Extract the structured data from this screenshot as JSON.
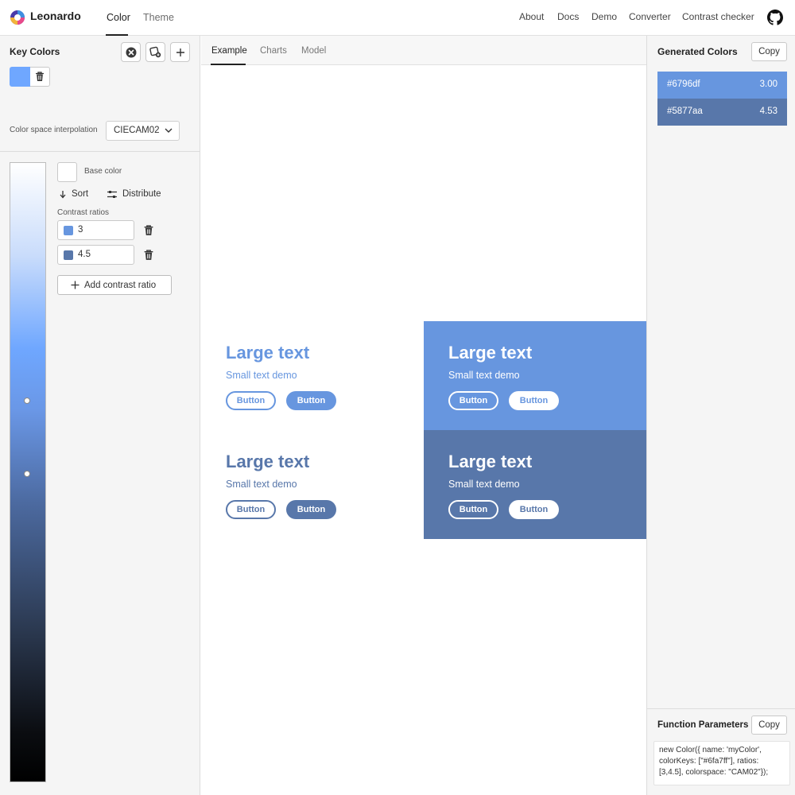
{
  "header": {
    "app_title": "Leonardo",
    "tabs": [
      {
        "label": "Color",
        "active": true
      },
      {
        "label": "Theme",
        "active": false
      }
    ],
    "nav": [
      "About",
      "Docs",
      "Demo",
      "Converter",
      "Contrast checker"
    ],
    "icons": {
      "logo": "leonardo-logo-icon",
      "github": "github-icon"
    }
  },
  "left_panel": {
    "key_colors_title": "Key Colors",
    "key_colors": [
      "#6fa7ff"
    ],
    "interpolation_label": "Color space interpolation",
    "interpolation_value": "CIECAM02",
    "base_color_label": "Base color",
    "sort_label": "Sort",
    "distribute_label": "Distribute",
    "contrast_ratios_label": "Contrast ratios",
    "ratios": [
      {
        "value": "3",
        "color": "#6796df"
      },
      {
        "value": "4.5",
        "color": "#5877aa"
      }
    ],
    "add_ratio_label": "Add contrast ratio"
  },
  "main": {
    "tabs": [
      {
        "label": "Example",
        "active": true
      },
      {
        "label": "Charts",
        "active": false
      },
      {
        "label": "Model",
        "active": false
      }
    ],
    "demo": {
      "large_text": "Large text",
      "small_text": "Small text demo",
      "button_label": "Button"
    }
  },
  "right_panel": {
    "generated_title": "Generated Colors",
    "copy_label": "Copy",
    "generated": [
      {
        "hex": "#6796df",
        "ratio": "3.00"
      },
      {
        "hex": "#5877aa",
        "ratio": "4.53"
      }
    ],
    "function_title": "Function Parameters",
    "function_code": "new Color({ name: 'myColor', colorKeys: [\"#6fa7ff\"], ratios: [3,4.5], colorspace: \"CAM02\"});"
  },
  "colors": {
    "c1": "#6796df",
    "c2": "#5877aa",
    "key": "#6fa7ff"
  }
}
